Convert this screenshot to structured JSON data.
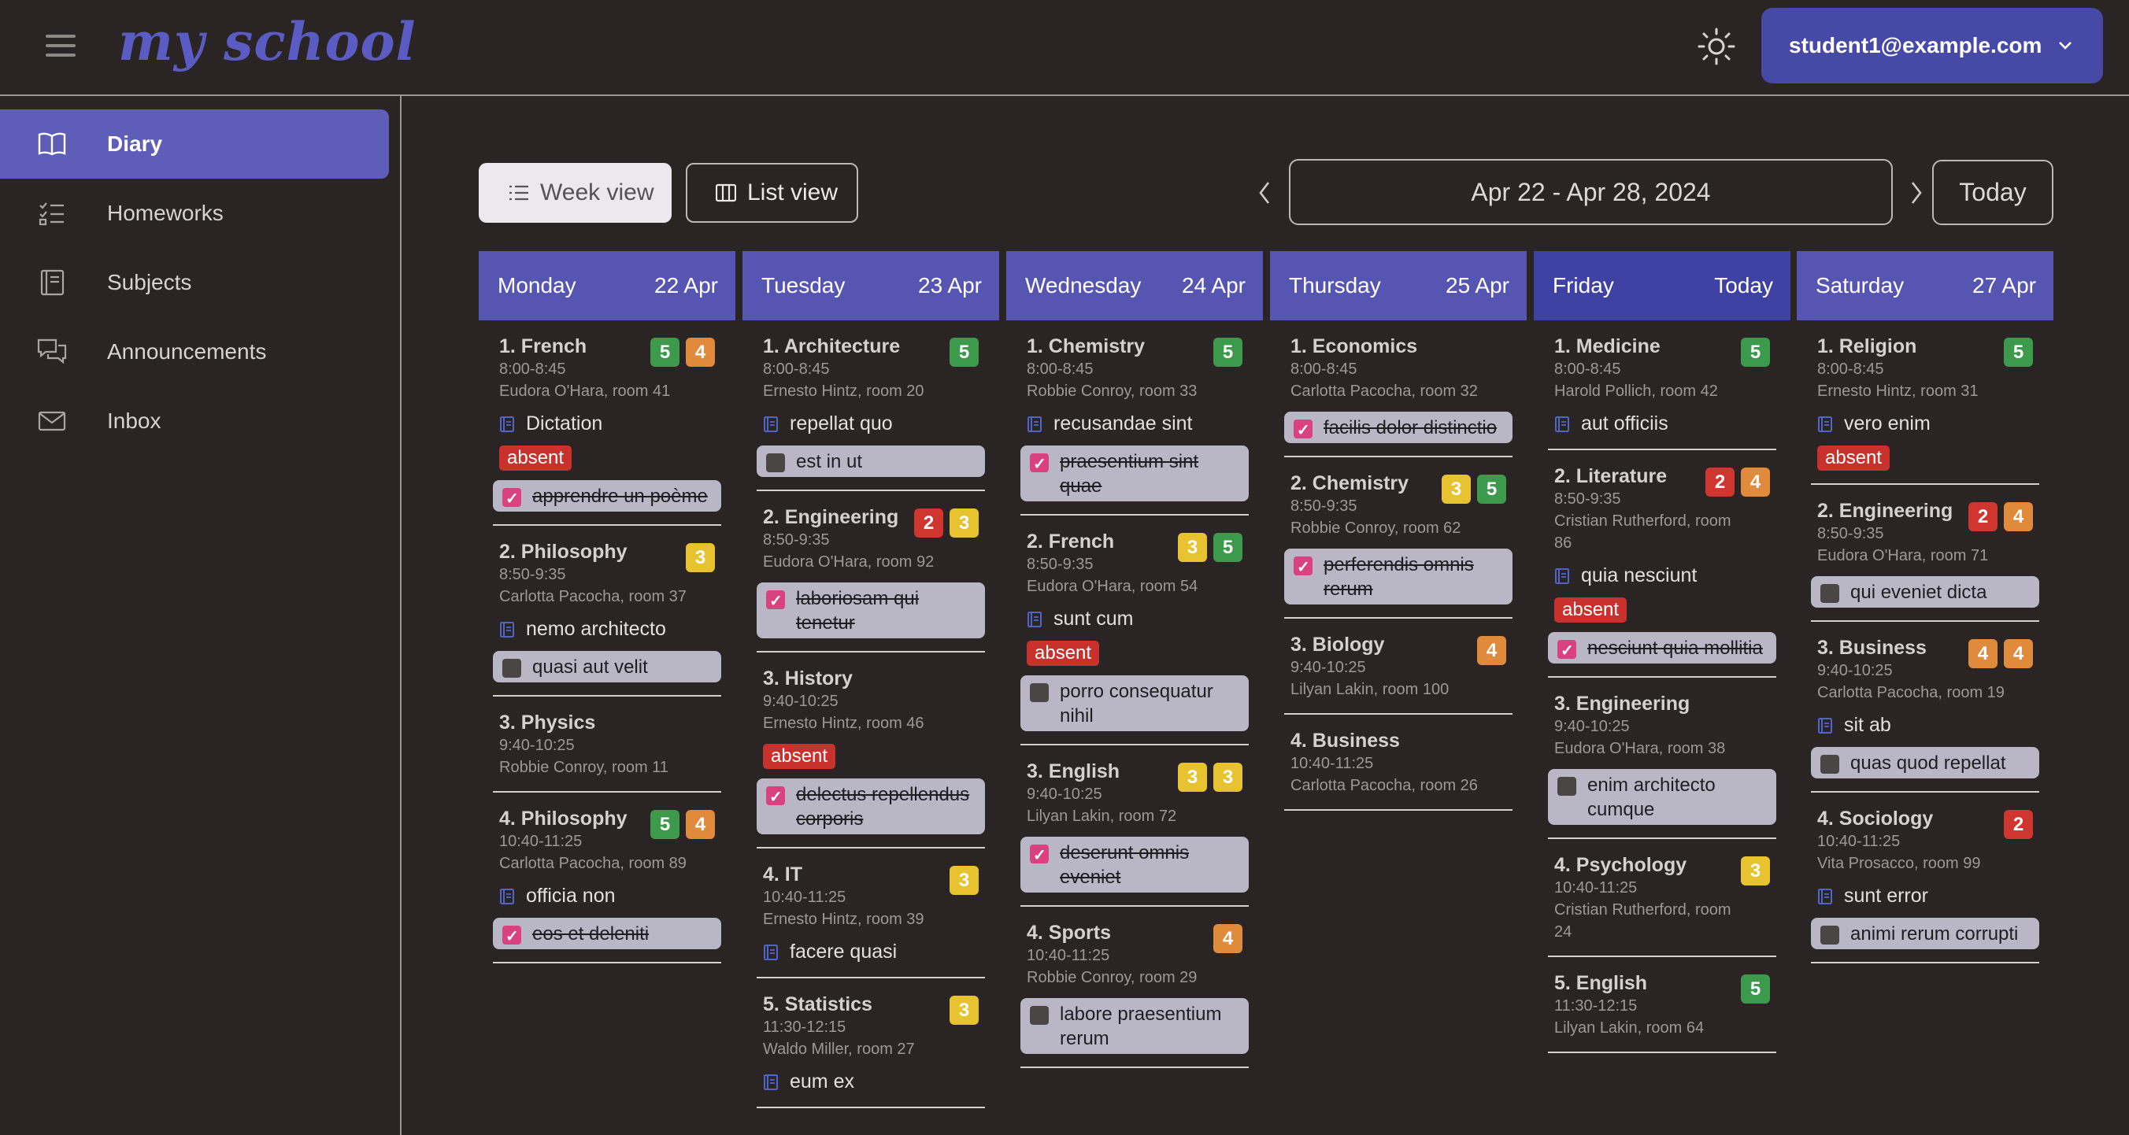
{
  "app": {
    "logo": "my school"
  },
  "user": {
    "email": "student1@example.com"
  },
  "sidebar": {
    "items": [
      {
        "label": "Diary",
        "icon": "book-open-icon",
        "active": true
      },
      {
        "label": "Homeworks",
        "icon": "checklist-icon",
        "active": false
      },
      {
        "label": "Subjects",
        "icon": "notebook-icon",
        "active": false
      },
      {
        "label": "Announcements",
        "icon": "chat-bubbles-icon",
        "active": false
      },
      {
        "label": "Inbox",
        "icon": "envelope-icon",
        "active": false
      }
    ]
  },
  "toolbar": {
    "week_view": "Week view",
    "list_view": "List view",
    "date_range": "Apr 22 - Apr 28, 2024",
    "today": "Today"
  },
  "colors": {
    "accent": "#5755b2",
    "today_header": "#3f41a3",
    "absent": "#c8312c",
    "green": "#3d9a4d",
    "orange": "#e08a3c",
    "yellow": "#e6c32f",
    "red": "#cf3630"
  },
  "days": [
    {
      "name": "Monday",
      "date": "22 Apr",
      "lessons": [
        {
          "title": "1. French",
          "time": "8:00-8:45",
          "teacher": "Eudora O'Hara, room 41",
          "grades": [
            5,
            4
          ],
          "topic": "Dictation",
          "absent": "absent",
          "homework": {
            "text": "apprendre un poème",
            "done": true
          }
        },
        {
          "title": "2. Philosophy",
          "time": "8:50-9:35",
          "teacher": "Carlotta Pacocha, room 37",
          "grades": [
            3
          ],
          "topic": "nemo architecto",
          "homework": {
            "text": "quasi aut velit",
            "done": false
          }
        },
        {
          "title": "3. Physics",
          "time": "9:40-10:25",
          "teacher": "Robbie Conroy, room 11",
          "grades": []
        },
        {
          "title": "4. Philosophy",
          "time": "10:40-11:25",
          "teacher": "Carlotta Pacocha, room 89",
          "grades": [
            5,
            4
          ],
          "topic": "officia non",
          "homework": {
            "text": "eos et deleniti",
            "done": true
          }
        }
      ]
    },
    {
      "name": "Tuesday",
      "date": "23 Apr",
      "lessons": [
        {
          "title": "1. Architecture",
          "time": "8:00-8:45",
          "teacher": "Ernesto Hintz, room 20",
          "grades": [
            5
          ],
          "topic": "repellat quo",
          "homework": {
            "text": "est in ut",
            "done": false
          }
        },
        {
          "title": "2. Engineering",
          "time": "8:50-9:35",
          "teacher": "Eudora O'Hara, room 92",
          "grades": [
            2,
            3
          ],
          "homework": {
            "text": "laboriosam qui tenetur",
            "done": true
          }
        },
        {
          "title": "3. History",
          "time": "9:40-10:25",
          "teacher": "Ernesto Hintz, room 46",
          "grades": [],
          "absent": "absent",
          "homework": {
            "text": "delectus repellendus corporis",
            "done": true
          }
        },
        {
          "title": "4. IT",
          "time": "10:40-11:25",
          "teacher": "Ernesto Hintz, room 39",
          "grades": [
            3
          ],
          "topic": "facere quasi"
        },
        {
          "title": "5. Statistics",
          "time": "11:30-12:15",
          "teacher": "Waldo Miller, room 27",
          "grades": [
            3
          ],
          "topic": "eum ex"
        }
      ]
    },
    {
      "name": "Wednesday",
      "date": "24 Apr",
      "lessons": [
        {
          "title": "1. Chemistry",
          "time": "8:00-8:45",
          "teacher": "Robbie Conroy, room 33",
          "grades": [
            5
          ],
          "topic": "recusandae sint",
          "homework": {
            "text": "praesentium sint quae",
            "done": true
          }
        },
        {
          "title": "2. French",
          "time": "8:50-9:35",
          "teacher": "Eudora O'Hara, room 54",
          "grades": [
            3,
            5
          ],
          "topic": "sunt cum",
          "absent": "absent",
          "homework": {
            "text": "porro consequatur nihil",
            "done": false
          }
        },
        {
          "title": "3. English",
          "time": "9:40-10:25",
          "teacher": "Lilyan Lakin, room 72",
          "grades": [
            3,
            3
          ],
          "homework": {
            "text": "deserunt omnis eveniet",
            "done": true
          }
        },
        {
          "title": "4. Sports",
          "time": "10:40-11:25",
          "teacher": "Robbie Conroy, room 29",
          "grades": [
            4
          ],
          "homework": {
            "text": "labore praesentium rerum",
            "done": false
          }
        }
      ]
    },
    {
      "name": "Thursday",
      "date": "25 Apr",
      "lessons": [
        {
          "title": "1. Economics",
          "time": "8:00-8:45",
          "teacher": "Carlotta Pacocha, room 32",
          "grades": [],
          "homework": {
            "text": "facilis dolor distinctio",
            "done": true
          }
        },
        {
          "title": "2. Chemistry",
          "time": "8:50-9:35",
          "teacher": "Robbie Conroy, room 62",
          "grades": [
            3,
            5
          ],
          "homework": {
            "text": "perferendis omnis rerum",
            "done": true
          }
        },
        {
          "title": "3. Biology",
          "time": "9:40-10:25",
          "teacher": "Lilyan Lakin, room 100",
          "grades": [
            4
          ]
        },
        {
          "title": "4. Business",
          "time": "10:40-11:25",
          "teacher": "Carlotta Pacocha, room 26",
          "grades": []
        }
      ]
    },
    {
      "name": "Friday",
      "date": "Today",
      "today": true,
      "lessons": [
        {
          "title": "1. Medicine",
          "time": "8:00-8:45",
          "teacher": "Harold Pollich, room 42",
          "grades": [
            5
          ],
          "topic": "aut officiis"
        },
        {
          "title": "2. Literature",
          "time": "8:50-9:35",
          "teacher": "Cristian Rutherford, room 86",
          "grades": [
            2,
            4
          ],
          "topic": "quia nesciunt",
          "absent": "absent",
          "homework": {
            "text": "nesciunt quia mollitia",
            "done": true
          }
        },
        {
          "title": "3. Engineering",
          "time": "9:40-10:25",
          "teacher": "Eudora O'Hara, room 38",
          "grades": [],
          "homework": {
            "text": "enim architecto cumque",
            "done": false
          }
        },
        {
          "title": "4. Psychology",
          "time": "10:40-11:25",
          "teacher": "Cristian Rutherford, room 24",
          "grades": [
            3
          ]
        },
        {
          "title": "5. English",
          "time": "11:30-12:15",
          "teacher": "Lilyan Lakin, room 64",
          "grades": [
            5
          ]
        }
      ]
    },
    {
      "name": "Saturday",
      "date": "27 Apr",
      "lessons": [
        {
          "title": "1. Religion",
          "time": "8:00-8:45",
          "teacher": "Ernesto Hintz, room 31",
          "grades": [
            5
          ],
          "topic": "vero enim",
          "absent": "absent"
        },
        {
          "title": "2. Engineering",
          "time": "8:50-9:35",
          "teacher": "Eudora O'Hara, room 71",
          "grades": [
            2,
            4
          ],
          "homework": {
            "text": "qui eveniet dicta",
            "done": false
          }
        },
        {
          "title": "3. Business",
          "time": "9:40-10:25",
          "teacher": "Carlotta Pacocha, room 19",
          "grades": [
            4,
            4
          ],
          "topic": "sit ab",
          "homework": {
            "text": "quas quod repellat",
            "done": false
          }
        },
        {
          "title": "4. Sociology",
          "time": "10:40-11:25",
          "teacher": "Vita Prosacco, room 99",
          "grades": [
            2
          ],
          "topic": "sunt error",
          "homework": {
            "text": "animi rerum corrupti",
            "done": false
          }
        }
      ]
    }
  ]
}
